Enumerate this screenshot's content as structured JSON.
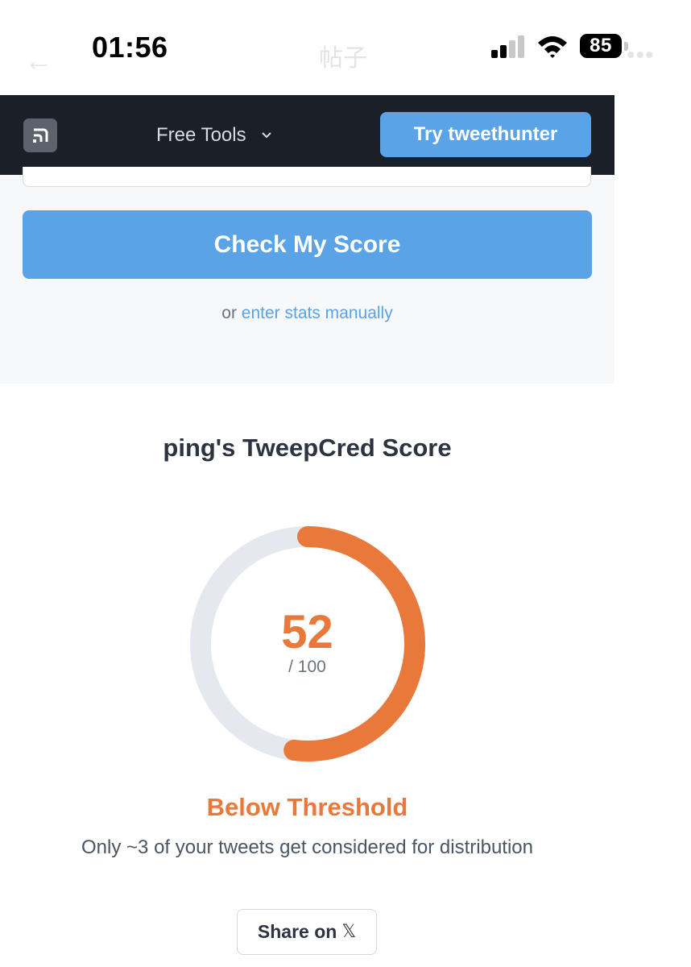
{
  "status_bar": {
    "time": "01:56",
    "battery_level": "85",
    "signal_bars_filled": 2,
    "signal_bars_total": 4,
    "icons": [
      "signal-icon",
      "wifi-icon",
      "battery-icon"
    ]
  },
  "native_header": {
    "back_icon": "back-arrow-icon",
    "title": "帖子",
    "more_icon": "more-icon"
  },
  "navbar": {
    "logo_icon": "tweethunter-logo-icon",
    "dropdown_label": "Free Tools",
    "dropdown_icon": "chevron-down-icon",
    "cta_label": "Try tweethunter"
  },
  "form": {
    "check_button_label": "Check My Score",
    "manual_prefix": "or",
    "manual_link_label": "enter stats manually"
  },
  "score": {
    "title": "ping's TweepCred Score",
    "value": 52,
    "value_text": "52",
    "max_text": "/ 100",
    "max": 100,
    "status_label": "Below Threshold",
    "status_description": "Only ~3 of your tweets get considered for distribution"
  },
  "share": {
    "label": "Share on",
    "logo_text": "𝕏",
    "logo_icon": "x-logo-icon"
  },
  "colors": {
    "nav_background": "#1b1f27",
    "accent_blue": "#5aa3e6",
    "score_orange": "#e8793a",
    "gauge_track": "#e5e8ee",
    "form_background": "#f7f8fa"
  }
}
